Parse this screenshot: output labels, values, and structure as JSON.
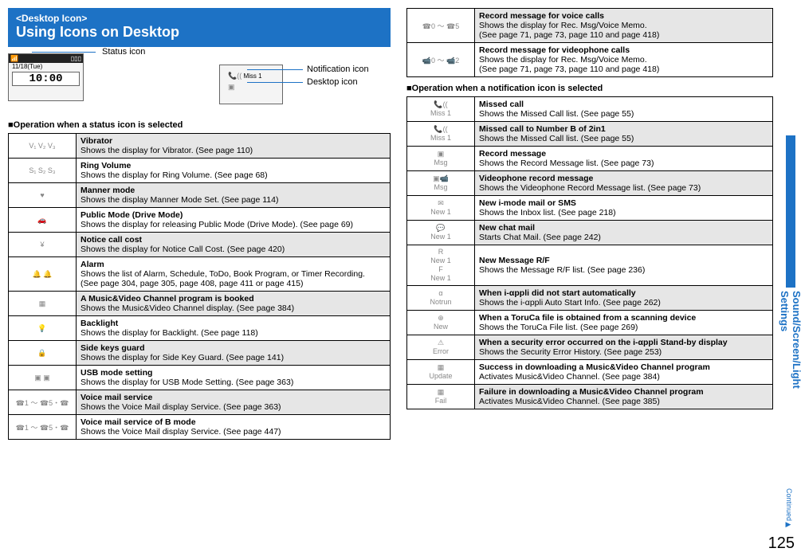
{
  "header": {
    "pre": "<Desktop Icon>",
    "title": "Using Icons on Desktop"
  },
  "diagram": {
    "status_label": "Status icon",
    "notification_label": "Notification icon",
    "desktop_label": "Desktop icon",
    "phone_date": "11/18(Tue)",
    "phone_time": "10:00",
    "miss_text": "Miss 1"
  },
  "left": {
    "subhead": "Operation when a status icon is selected",
    "rows": [
      {
        "icon": "V₁ V₂ V₃",
        "title": "Vibrator",
        "desc": "Shows the display for Vibrator. (See page 110)"
      },
      {
        "icon": "S₁ S₂ S₃",
        "title": "Ring Volume",
        "desc": "Shows the display for Ring Volume. (See page 68)"
      },
      {
        "icon": "♥",
        "title": "Manner mode",
        "desc": "Shows the display Manner Mode Set. (See page 114)"
      },
      {
        "icon": "🚗",
        "title": "Public Mode (Drive Mode)",
        "desc": "Shows the display for releasing Public Mode (Drive Mode). (See page 69)"
      },
      {
        "icon": "¥",
        "title": "Notice call cost",
        "desc": "Shows the display for Notice Call Cost. (See page 420)"
      },
      {
        "icon": "🔔 🔔",
        "title": "Alarm",
        "desc": "Shows the list of Alarm, Schedule, ToDo, Book Program, or Timer Recording.\n(See page 304, page 305, page 408, page 411 or page 415)"
      },
      {
        "icon": "▦",
        "title": "A Music&Video Channel program is booked",
        "desc": "Shows the Music&Video Channel display. (See page 384)"
      },
      {
        "icon": "💡",
        "title": "Backlight",
        "desc": "Shows the display for Backlight. (See page 118)"
      },
      {
        "icon": "🔒",
        "title": "Side keys guard",
        "desc": "Shows the display for Side Key Guard. (See page 141)"
      },
      {
        "icon": "▣ ▣",
        "title": "USB mode setting",
        "desc": "Shows the display for USB Mode Setting. (See page 363)"
      },
      {
        "icon": "☎1 ～ ☎5・☎",
        "title": "Voice mail service",
        "desc": "Shows the Voice Mail display Service. (See page 363)"
      },
      {
        "icon": "☎1 ～ ☎5・☎",
        "title": "Voice mail service of B mode",
        "desc": "Shows the Voice Mail display Service. (See page 447)"
      }
    ]
  },
  "top_right": {
    "rows": [
      {
        "icon": "☎0 ～ ☎5",
        "title": "Record message for voice calls",
        "desc": "Shows the display for Rec. Msg/Voice Memo.\n(See page 71, page 73, page 110 and page 418)"
      },
      {
        "icon": "📹0 ～ 📹2",
        "title": "Record message for videophone calls",
        "desc": "Shows the display for Rec. Msg/Voice Memo.\n(See page 71, page 73, page 110 and page 418)"
      }
    ]
  },
  "right": {
    "subhead": "Operation when a notification icon is selected",
    "rows": [
      {
        "icon": "📞((\nMiss 1",
        "title": "Missed call",
        "desc": "Shows the Missed Call list. (See page 55)"
      },
      {
        "icon": "📞((\nMiss 1",
        "title": "Missed call to Number B of 2in1",
        "desc": "Shows the Missed Call list. (See page 55)"
      },
      {
        "icon": "▣\nMsg",
        "title": "Record message",
        "desc": "Shows the Record Message list. (See page 73)"
      },
      {
        "icon": "▣📹\nMsg",
        "title": "Videophone record message",
        "desc": "Shows the Videophone Record Message list. (See page 73)"
      },
      {
        "icon": "✉\nNew 1",
        "title": "New i-mode mail or SMS",
        "desc": "Shows the Inbox list. (See page 218)"
      },
      {
        "icon": "💬\nNew 1",
        "title": "New chat mail",
        "desc": "Starts Chat Mail. (See page 242)"
      },
      {
        "icon": "R\nNew 1\nF\nNew 1",
        "title": "New Message R/F",
        "desc": "Shows the Message R/F list. (See page 236)"
      },
      {
        "icon": "α\nNotrun",
        "title": "When i-αppli did not start automatically",
        "desc": "Shows the i-αppli Auto Start Info. (See page 262)"
      },
      {
        "icon": "⊕\nNew",
        "title": "When a ToruCa file is obtained from a scanning device",
        "desc": "Shows the ToruCa File list. (See page 269)"
      },
      {
        "icon": "⚠\nError",
        "title": "When a security error occurred on the i-αppli Stand-by display",
        "desc": "Shows the Security Error History. (See page 253)"
      },
      {
        "icon": "▦\nUpdate",
        "title": "Success in downloading a Music&Video Channel program",
        "desc": "Activates Music&Video Channel. (See page 384)"
      },
      {
        "icon": "▦\nFail",
        "title": "Failure in downloading a Music&Video Channel program",
        "desc": "Activates Music&Video Channel. (See page 385)"
      }
    ]
  },
  "side_tab": "Sound/Screen/Light Settings",
  "continued": "Continued▶",
  "page_number": "125"
}
